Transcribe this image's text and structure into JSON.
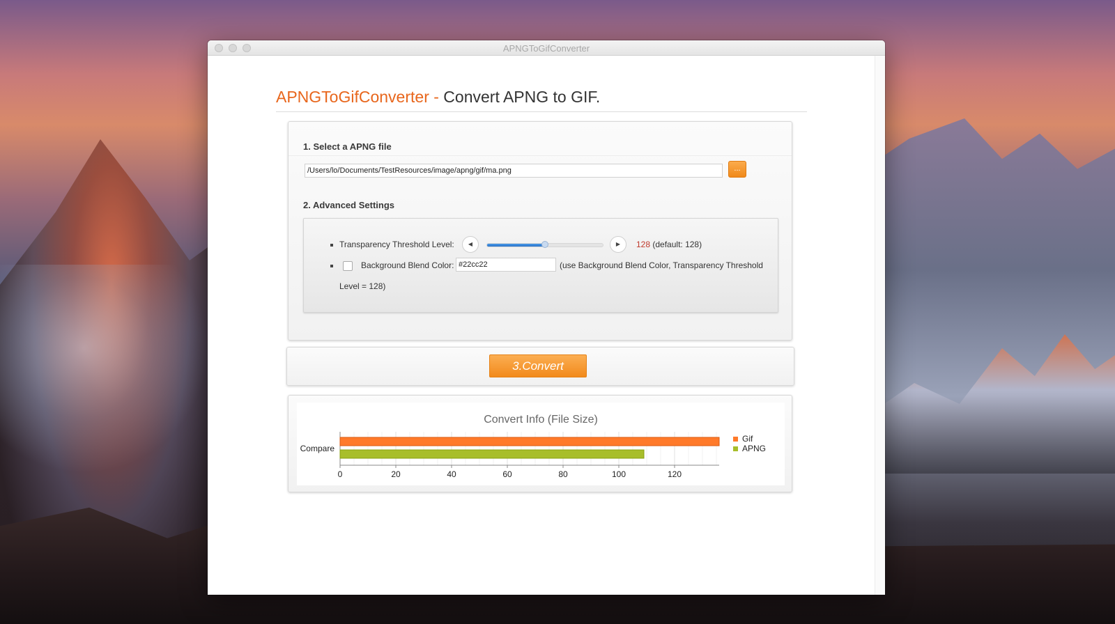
{
  "window": {
    "title": "APNGToGifConverter"
  },
  "header": {
    "brand": "APNGToGifConverter -",
    "tagline": "Convert APNG to GIF."
  },
  "section1": {
    "title": "1. Select a APNG file",
    "file_path": "/Users/lo/Documents/TestResources/image/apng/gif/ma.png",
    "browse_label": "..."
  },
  "section2": {
    "title": "2. Advanced Settings",
    "threshold_label": "Transparency Threshold Level:",
    "threshold_value": "128",
    "threshold_default": "(default: 128)",
    "threshold_fraction": 0.5,
    "blend_label": "Background Blend Color:",
    "blend_checked": false,
    "blend_color": "#22cc22",
    "blend_hint_1": "(use Background Blend Color, Transparency Threshold",
    "blend_hint_2": "Level = 128)"
  },
  "convert": {
    "label": "3.Convert"
  },
  "colors": {
    "accent": "#e8661c",
    "button_orange": "#f28a1c",
    "gif_bar": "#ff7a2a",
    "apng_bar": "#a8be2a"
  },
  "chart_data": {
    "type": "bar",
    "orientation": "horizontal",
    "title": "Convert Info (File Size)",
    "categories": [
      "Compare"
    ],
    "series": [
      {
        "name": "Gif",
        "values": [
          136
        ]
      },
      {
        "name": "APNG",
        "values": [
          109
        ]
      }
    ],
    "xlim": [
      0,
      136
    ],
    "xticks": [
      0,
      20,
      40,
      60,
      80,
      100,
      120
    ],
    "legend": "right",
    "grid": true
  }
}
